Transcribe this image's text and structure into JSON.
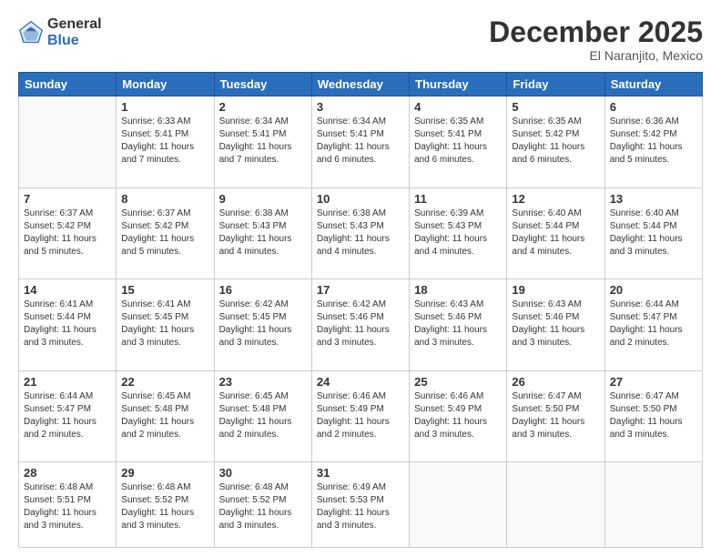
{
  "logo": {
    "general": "General",
    "blue": "Blue"
  },
  "header": {
    "title": "December 2025",
    "location": "El Naranjito, Mexico"
  },
  "weekdays": [
    "Sunday",
    "Monday",
    "Tuesday",
    "Wednesday",
    "Thursday",
    "Friday",
    "Saturday"
  ],
  "weeks": [
    [
      {
        "day": "",
        "info": ""
      },
      {
        "day": "1",
        "info": "Sunrise: 6:33 AM\nSunset: 5:41 PM\nDaylight: 11 hours\nand 7 minutes."
      },
      {
        "day": "2",
        "info": "Sunrise: 6:34 AM\nSunset: 5:41 PM\nDaylight: 11 hours\nand 7 minutes."
      },
      {
        "day": "3",
        "info": "Sunrise: 6:34 AM\nSunset: 5:41 PM\nDaylight: 11 hours\nand 6 minutes."
      },
      {
        "day": "4",
        "info": "Sunrise: 6:35 AM\nSunset: 5:41 PM\nDaylight: 11 hours\nand 6 minutes."
      },
      {
        "day": "5",
        "info": "Sunrise: 6:35 AM\nSunset: 5:42 PM\nDaylight: 11 hours\nand 6 minutes."
      },
      {
        "day": "6",
        "info": "Sunrise: 6:36 AM\nSunset: 5:42 PM\nDaylight: 11 hours\nand 5 minutes."
      }
    ],
    [
      {
        "day": "7",
        "info": "Sunrise: 6:37 AM\nSunset: 5:42 PM\nDaylight: 11 hours\nand 5 minutes."
      },
      {
        "day": "8",
        "info": "Sunrise: 6:37 AM\nSunset: 5:42 PM\nDaylight: 11 hours\nand 5 minutes."
      },
      {
        "day": "9",
        "info": "Sunrise: 6:38 AM\nSunset: 5:43 PM\nDaylight: 11 hours\nand 4 minutes."
      },
      {
        "day": "10",
        "info": "Sunrise: 6:38 AM\nSunset: 5:43 PM\nDaylight: 11 hours\nand 4 minutes."
      },
      {
        "day": "11",
        "info": "Sunrise: 6:39 AM\nSunset: 5:43 PM\nDaylight: 11 hours\nand 4 minutes."
      },
      {
        "day": "12",
        "info": "Sunrise: 6:40 AM\nSunset: 5:44 PM\nDaylight: 11 hours\nand 4 minutes."
      },
      {
        "day": "13",
        "info": "Sunrise: 6:40 AM\nSunset: 5:44 PM\nDaylight: 11 hours\nand 3 minutes."
      }
    ],
    [
      {
        "day": "14",
        "info": "Sunrise: 6:41 AM\nSunset: 5:44 PM\nDaylight: 11 hours\nand 3 minutes."
      },
      {
        "day": "15",
        "info": "Sunrise: 6:41 AM\nSunset: 5:45 PM\nDaylight: 11 hours\nand 3 minutes."
      },
      {
        "day": "16",
        "info": "Sunrise: 6:42 AM\nSunset: 5:45 PM\nDaylight: 11 hours\nand 3 minutes."
      },
      {
        "day": "17",
        "info": "Sunrise: 6:42 AM\nSunset: 5:46 PM\nDaylight: 11 hours\nand 3 minutes."
      },
      {
        "day": "18",
        "info": "Sunrise: 6:43 AM\nSunset: 5:46 PM\nDaylight: 11 hours\nand 3 minutes."
      },
      {
        "day": "19",
        "info": "Sunrise: 6:43 AM\nSunset: 5:46 PM\nDaylight: 11 hours\nand 3 minutes."
      },
      {
        "day": "20",
        "info": "Sunrise: 6:44 AM\nSunset: 5:47 PM\nDaylight: 11 hours\nand 2 minutes."
      }
    ],
    [
      {
        "day": "21",
        "info": "Sunrise: 6:44 AM\nSunset: 5:47 PM\nDaylight: 11 hours\nand 2 minutes."
      },
      {
        "day": "22",
        "info": "Sunrise: 6:45 AM\nSunset: 5:48 PM\nDaylight: 11 hours\nand 2 minutes."
      },
      {
        "day": "23",
        "info": "Sunrise: 6:45 AM\nSunset: 5:48 PM\nDaylight: 11 hours\nand 2 minutes."
      },
      {
        "day": "24",
        "info": "Sunrise: 6:46 AM\nSunset: 5:49 PM\nDaylight: 11 hours\nand 2 minutes."
      },
      {
        "day": "25",
        "info": "Sunrise: 6:46 AM\nSunset: 5:49 PM\nDaylight: 11 hours\nand 3 minutes."
      },
      {
        "day": "26",
        "info": "Sunrise: 6:47 AM\nSunset: 5:50 PM\nDaylight: 11 hours\nand 3 minutes."
      },
      {
        "day": "27",
        "info": "Sunrise: 6:47 AM\nSunset: 5:50 PM\nDaylight: 11 hours\nand 3 minutes."
      }
    ],
    [
      {
        "day": "28",
        "info": "Sunrise: 6:48 AM\nSunset: 5:51 PM\nDaylight: 11 hours\nand 3 minutes."
      },
      {
        "day": "29",
        "info": "Sunrise: 6:48 AM\nSunset: 5:52 PM\nDaylight: 11 hours\nand 3 minutes."
      },
      {
        "day": "30",
        "info": "Sunrise: 6:48 AM\nSunset: 5:52 PM\nDaylight: 11 hours\nand 3 minutes."
      },
      {
        "day": "31",
        "info": "Sunrise: 6:49 AM\nSunset: 5:53 PM\nDaylight: 11 hours\nand 3 minutes."
      },
      {
        "day": "",
        "info": ""
      },
      {
        "day": "",
        "info": ""
      },
      {
        "day": "",
        "info": ""
      }
    ]
  ]
}
